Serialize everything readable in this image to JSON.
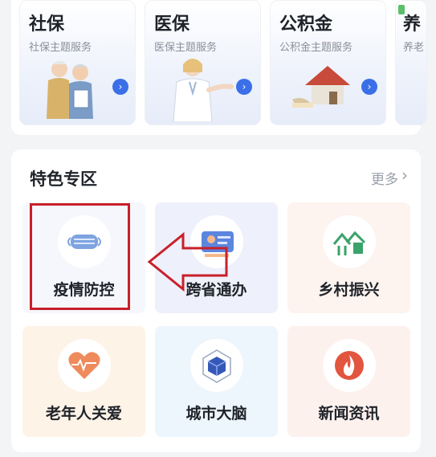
{
  "services": [
    {
      "title": "社保",
      "subtitle": "社保主题服务",
      "arrow_icon": "chevron-right-icon",
      "illustration": "elderly-couple-illustration"
    },
    {
      "title": "医保",
      "subtitle": "医保主题服务",
      "arrow_icon": "chevron-right-icon",
      "illustration": "doctor-illustration"
    },
    {
      "title": "公积金",
      "subtitle": "公积金主题服务",
      "arrow_icon": "chevron-right-icon",
      "illustration": "house-illustration"
    },
    {
      "title": "养",
      "subtitle": "养老",
      "arrow_icon": "chevron-right-icon",
      "illustration": ""
    }
  ],
  "zone": {
    "title": "特色专区",
    "more": "更多",
    "more_icon": "chevron-right-icon",
    "tiles": [
      {
        "label": "疫情防控",
        "icon": "face-mask-icon",
        "bg": "#f5f7fd",
        "highlighted": true
      },
      {
        "label": "跨省通办",
        "icon": "id-card-icon",
        "bg": "#eef0fb"
      },
      {
        "label": "乡村振兴",
        "icon": "village-icon",
        "bg": "#fdf3ef"
      },
      {
        "label": "老年人关爱",
        "icon": "heart-pulse-icon",
        "bg": "#fdf3e7"
      },
      {
        "label": "城市大脑",
        "icon": "hex-cube-icon",
        "bg": "#edf5fd"
      },
      {
        "label": "新闻资讯",
        "icon": "flame-icon",
        "bg": "#fdf1ee"
      }
    ]
  },
  "annotation": {
    "color": "#c8202a"
  },
  "colors": {
    "accent": "#3b6fe8",
    "text": "#1f2329",
    "muted": "#8a8f99"
  }
}
